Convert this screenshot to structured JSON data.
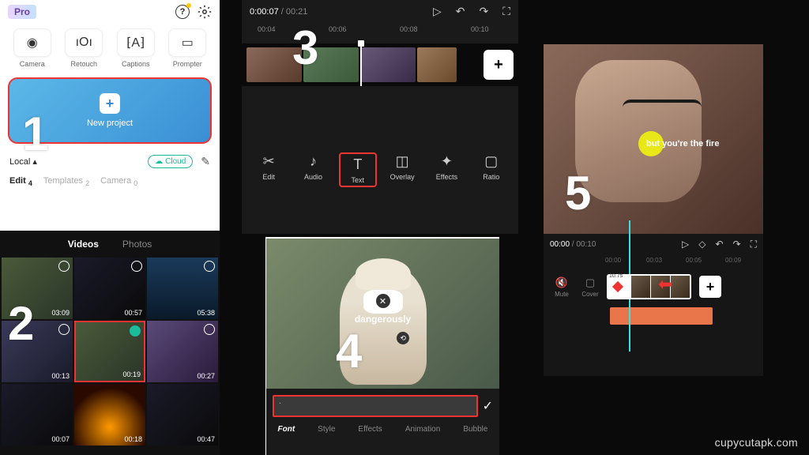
{
  "watermark": "cupycutapk.com",
  "steps": {
    "s1": "1",
    "s2": "2",
    "s3": "3",
    "s4": "4",
    "s5": "5"
  },
  "panel1": {
    "pro_badge": "Pro",
    "tools": {
      "camera": "Camera",
      "retouch": "Retouch",
      "captions": "Captions",
      "prompter": "Prompter"
    },
    "new_project": "New project",
    "local": "Local",
    "cloud": "Cloud",
    "tabs": {
      "edit": "Edit",
      "edit_n": "4",
      "templates": "Templates",
      "templates_n": "2",
      "camera": "Camera",
      "camera_n": "0"
    }
  },
  "panel2": {
    "tab_videos": "Videos",
    "tab_photos": "Photos",
    "durations": [
      "03:09",
      "00:57",
      "05:38",
      "00:13",
      "00:19",
      "00:27",
      "00:07",
      "00:18",
      "00:47"
    ]
  },
  "panel3": {
    "time_cur": "0:00:07",
    "time_total": "00:21",
    "ruler": [
      "00:04",
      "00:06",
      "00:08",
      "00:10"
    ],
    "tools": {
      "edit": "Edit",
      "audio": "Audio",
      "text": "Text",
      "overlay": "Overlay",
      "effects": "Effects",
      "ratio": "Ratio"
    }
  },
  "panel4": {
    "overlay_text": "dangerously",
    "input_placeholder": ".",
    "tabs": {
      "font": "Font",
      "style": "Style",
      "effects": "Effects",
      "animation": "Animation",
      "bubble": "Bubble"
    }
  },
  "panel5": {
    "lyric": "but you're the fire",
    "time_cur": "00:00",
    "time_total": "00:10",
    "ruler": [
      "00:00",
      "00:03",
      "00:05",
      "00:09"
    ],
    "mute": "Mute",
    "cover": "Cover",
    "kf_label": "10.7s"
  }
}
